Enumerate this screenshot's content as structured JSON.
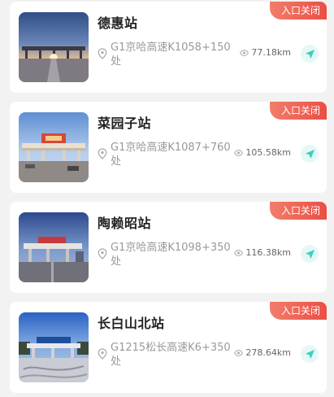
{
  "stations": [
    {
      "name": "德惠站",
      "status": "入口关闭",
      "address": "G1京哈高速K1058+150处",
      "distance": "77.18km",
      "photo": "toll-plaza-sunrise"
    },
    {
      "name": "菜园子站",
      "status": "入口关闭",
      "address": "G1京哈高速K1087+760处",
      "distance": "105.58km",
      "photo": "toll-plaza-daylight"
    },
    {
      "name": "陶赖昭站",
      "status": "入口关闭",
      "address": "G1京哈高速K1098+350处",
      "distance": "116.38km",
      "photo": "toll-plaza-cloudy"
    },
    {
      "name": "长白山北站",
      "status": "入口关闭",
      "address": "G1215松长高速K6+350处",
      "distance": "278.64km",
      "photo": "toll-plaza-snow"
    }
  ],
  "icons": {
    "location": "map-pin-icon",
    "distance": "eye-icon",
    "navigate": "navigation-arrow-icon"
  },
  "colors": {
    "badge": "#ea4f45",
    "navigate_accent": "#3fcfbf",
    "navigate_bg": "#e6f8f6"
  }
}
